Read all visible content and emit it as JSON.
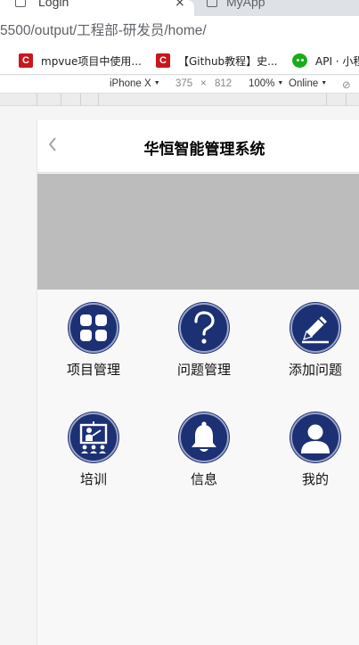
{
  "browser": {
    "tabs": [
      {
        "title": "Login",
        "active": true
      },
      {
        "title": "MyApp",
        "active": false
      }
    ],
    "close_glyph": "×",
    "url": "5500/output/工程部-研发员/home/",
    "bookmarks": [
      {
        "label": "mpvue项目中使用...",
        "icon": "csdn-icon"
      },
      {
        "label": "【Github教程】史...",
        "icon": "csdn-icon"
      },
      {
        "label": "API · 小程",
        "icon": "wechat-icon"
      }
    ]
  },
  "device_toolbar": {
    "device": "iPhone X",
    "width": "375",
    "times": "×",
    "height": "812",
    "zoom": "100%",
    "network": "Online"
  },
  "app": {
    "title": "华恒智能管理系统",
    "accent_color": "#1c3074",
    "banner_color": "#bcbcbc",
    "menu": [
      {
        "label": "项目管理",
        "icon": "grid-apps-icon"
      },
      {
        "label": "问题管理",
        "icon": "question-icon"
      },
      {
        "label": "添加问题",
        "icon": "edit-pencil-icon"
      },
      {
        "label": "培训",
        "icon": "training-presentation-icon"
      },
      {
        "label": "信息",
        "icon": "bell-icon"
      },
      {
        "label": "我的",
        "icon": "user-icon"
      }
    ]
  }
}
